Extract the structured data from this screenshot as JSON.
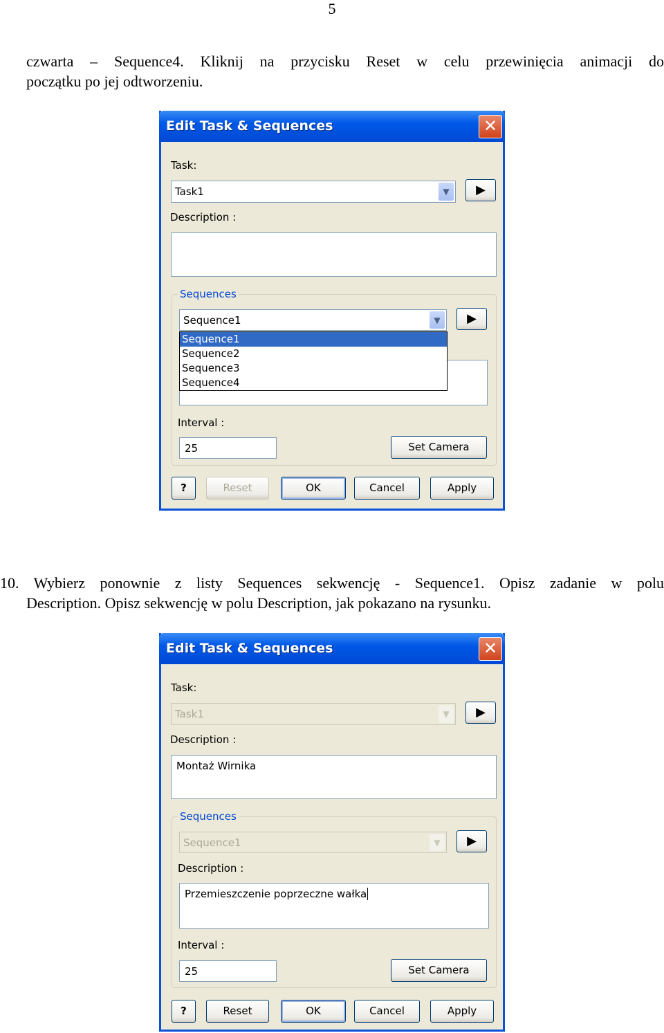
{
  "page_number": "5",
  "para1": {
    "line1": "czwarta – Sequence4. Kliknij na przycisku Reset w celu przewinięcia animacji do",
    "line2": "początku po jej odtworzeniu."
  },
  "para2": {
    "line1": "10. Wybierz ponownie z listy Sequences sekwencję - Sequence1. Opisz zadanie w polu",
    "line2": "Description. Opisz sekwencję w polu Description, jak pokazano na rysunku."
  },
  "colors": {
    "titlebar": "#0058e6",
    "dialog_bg": "#ece9d8",
    "selection": "#316ac5",
    "group_label": "#0046d5"
  },
  "dialog1": {
    "title": "Edit Task & Sequences",
    "task_label": "Task:",
    "task_value": "Task1",
    "description_label": "Description :",
    "description_value": "",
    "sequences_label": "Sequences",
    "sequence_value": "Sequence1",
    "sequence_options": [
      "Sequence1",
      "Sequence2",
      "Sequence3",
      "Sequence4"
    ],
    "selected_option": "Sequence1",
    "interval_label": "Interval :",
    "interval_value": "25",
    "set_camera": "Set Camera",
    "help": "?",
    "reset": "Reset",
    "ok": "OK",
    "cancel": "Cancel",
    "apply": "Apply",
    "close": "✕",
    "play": "▶"
  },
  "dialog2": {
    "title": "Edit Task & Sequences",
    "task_label": "Task:",
    "task_value": "Task1",
    "description_label": "Description :",
    "description_value": "Montaż Wirnika",
    "sequences_label": "Sequences",
    "sequence_value": "Sequence1",
    "seq_description_label": "Description :",
    "seq_description_value": "Przemieszczenie poprzeczne wałka",
    "interval_label": "Interval :",
    "interval_value": "25",
    "set_camera": "Set Camera",
    "help": "?",
    "reset": "Reset",
    "ok": "OK",
    "cancel": "Cancel",
    "apply": "Apply",
    "close": "✕",
    "play": "▶"
  }
}
